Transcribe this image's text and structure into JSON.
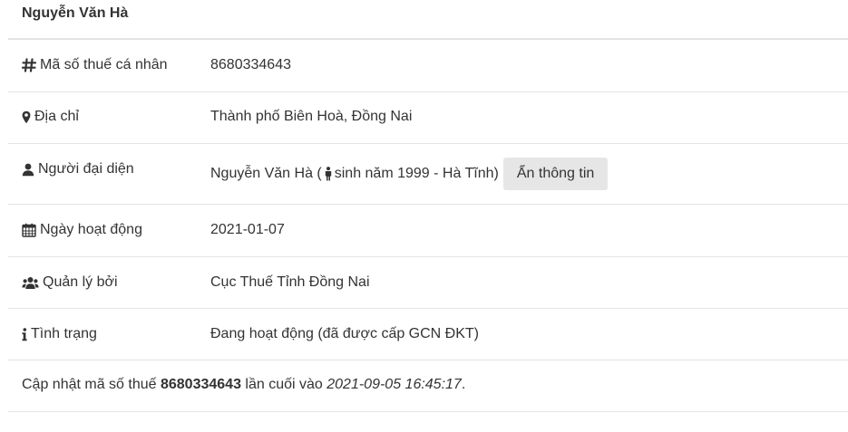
{
  "company": {
    "name": "Nguyễn Văn Hà"
  },
  "rows": [
    {
      "label": "Mã số thuế cá nhân",
      "value": "8680334643"
    },
    {
      "label": "Địa chỉ",
      "value": "Thành phố Biên Hoà, Đồng Nai"
    },
    {
      "label": "Người đại diện",
      "value_name": "Nguyễn Văn Hà (",
      "value_detail": "sinh năm 1999 - Hà Tĩnh)",
      "button": "Ẩn thông tin"
    },
    {
      "label": "Ngày hoạt động",
      "value": "2021-01-07"
    },
    {
      "label": "Quản lý bởi",
      "value": "Cục Thuế Tỉnh Đồng Nai"
    },
    {
      "label": "Tình trạng",
      "value": "Đang hoạt động (đã được cấp GCN ĐKT)"
    }
  ],
  "footer": {
    "prefix": "Cập nhật mã số thuế ",
    "tax_code": "8680334643",
    "middle": " lần cuối vào ",
    "timestamp": "2021-09-05 16:45:17",
    "suffix": "."
  },
  "icons": [
    "hash-icon",
    "map-marker-icon",
    "user-icon",
    "calendar-icon",
    "users-icon",
    "info-icon",
    "male-icon"
  ]
}
